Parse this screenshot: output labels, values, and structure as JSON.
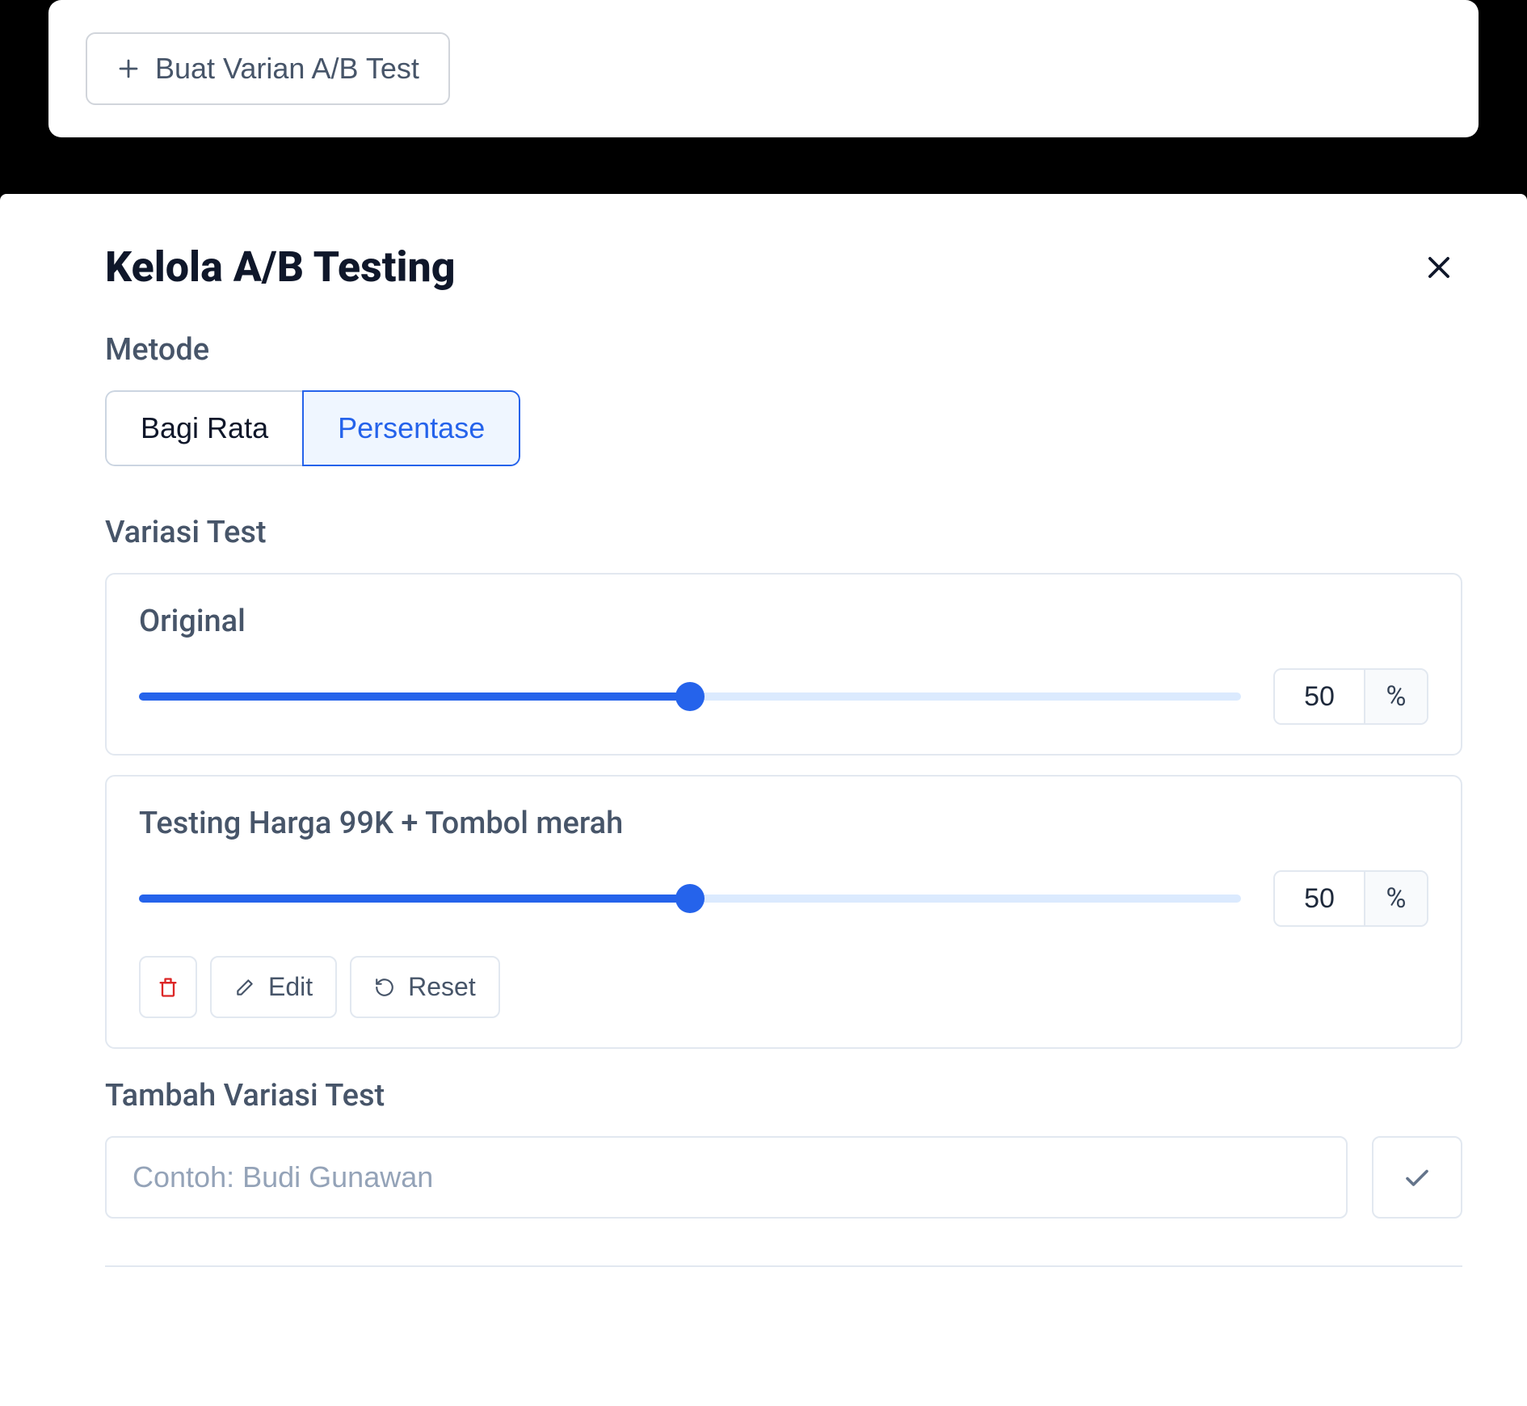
{
  "topCard": {
    "createVariantLabel": "Buat Varian A/B Test"
  },
  "modal": {
    "title": "Kelola A/B Testing",
    "methodLabel": "Metode",
    "methods": {
      "equal": "Bagi Rata",
      "percentage": "Persentase"
    },
    "variationsLabel": "Variasi Test",
    "variations": [
      {
        "name": "Original",
        "percentage": "50",
        "suffix": "%"
      },
      {
        "name": "Testing Harga 99K + Tombol merah",
        "percentage": "50",
        "suffix": "%"
      }
    ],
    "actions": {
      "edit": "Edit",
      "reset": "Reset"
    },
    "addSection": {
      "label": "Tambah Variasi Test",
      "placeholder": "Contoh: Budi Gunawan"
    }
  }
}
